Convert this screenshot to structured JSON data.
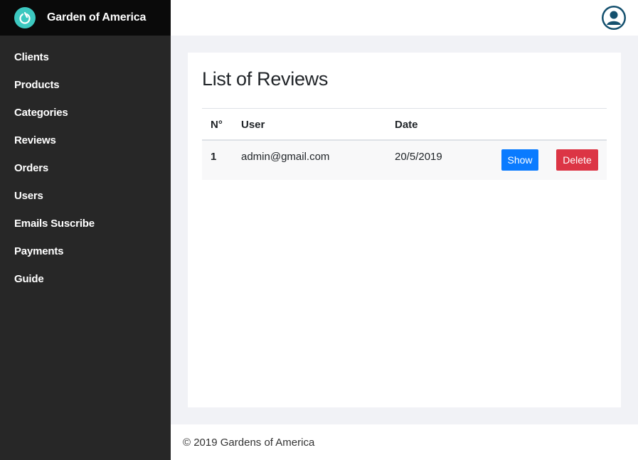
{
  "brand": {
    "name": "Garden of America",
    "logo_icon": "power-icon",
    "logo_color": "#3cc8c0"
  },
  "sidebar": {
    "items": [
      {
        "label": "Clients"
      },
      {
        "label": "Products"
      },
      {
        "label": "Categories"
      },
      {
        "label": "Reviews"
      },
      {
        "label": "Orders"
      },
      {
        "label": "Users"
      },
      {
        "label": "Emails Suscribe"
      },
      {
        "label": "Payments"
      },
      {
        "label": "Guide"
      }
    ]
  },
  "header": {
    "avatar_icon": "user-avatar-icon"
  },
  "main": {
    "title": "List of Reviews",
    "table": {
      "columns": [
        "N°",
        "User",
        "Date"
      ],
      "rows": [
        {
          "number": "1",
          "user": "admin@gmail.com",
          "date": "20/5/2019",
          "show_label": "Show",
          "delete_label": "Delete"
        }
      ]
    }
  },
  "footer": {
    "text": "© 2019 Gardens of America"
  },
  "colors": {
    "sidebar": "#272727",
    "brand_bar": "#0a0a0a",
    "show_button": "#0a7bff",
    "delete_button": "#dc3545",
    "avatar": "#14506e"
  }
}
